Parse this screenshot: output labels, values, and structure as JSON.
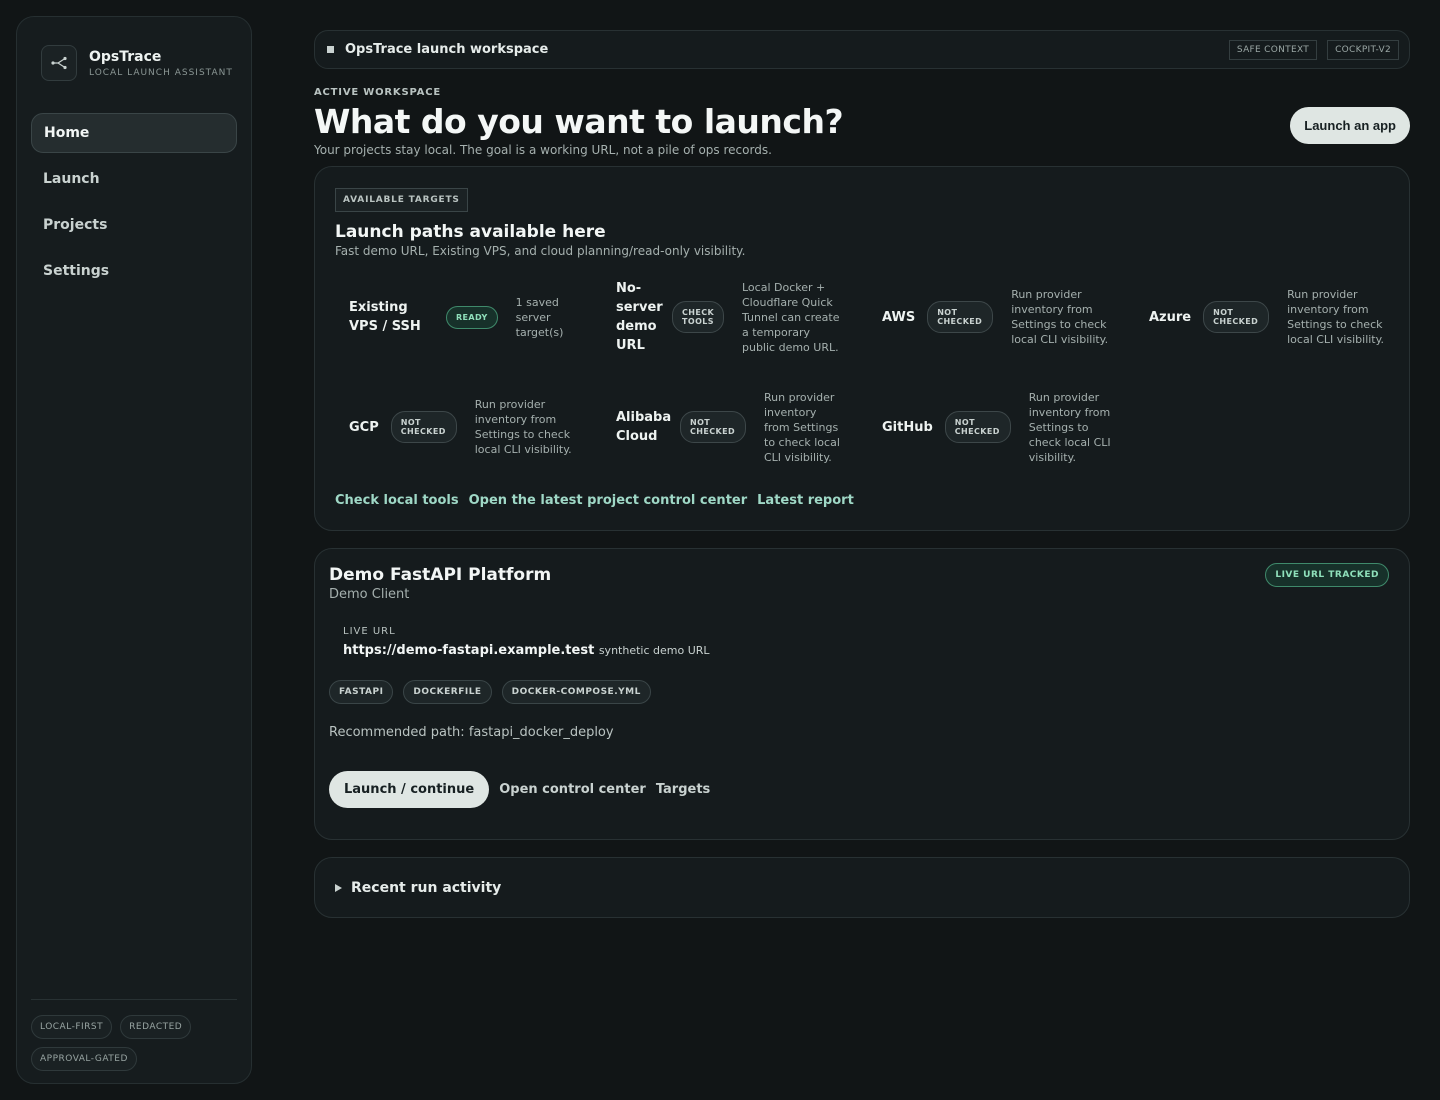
{
  "brand": {
    "name": "OpsTrace",
    "subtitle": "LOCAL LAUNCH ASSISTANT",
    "icon": "share-branch-icon"
  },
  "nav": {
    "items": [
      {
        "label": "Home",
        "active": true
      },
      {
        "label": "Launch",
        "active": false
      },
      {
        "label": "Projects",
        "active": false
      },
      {
        "label": "Settings",
        "active": false
      }
    ]
  },
  "sidebar_pills": [
    "LOCAL-FIRST",
    "REDACTED",
    "APPROVAL-GATED"
  ],
  "topbar": {
    "title": "OpsTrace launch workspace",
    "tags": [
      "SAFE CONTEXT",
      "COCKPIT-V2"
    ]
  },
  "hero": {
    "eyebrow": "ACTIVE WORKSPACE",
    "title": "What do you want to launch?",
    "subtitle": "Your projects stay local. The goal is a working URL, not a pile of ops records.",
    "button": "Launch an app"
  },
  "targets": {
    "badge": "AVAILABLE TARGETS",
    "title": "Launch paths available here",
    "subtitle": "Fast demo URL, Existing VPS, and cloud planning/read-only visibility.",
    "items": [
      {
        "name": "Existing VPS / SSH",
        "status": "READY",
        "desc": "1 saved server target(s)"
      },
      {
        "name": "No-server demo URL",
        "status": "CHECK TOOLS",
        "desc": "Local Docker + Cloudflare Quick Tunnel can create a temporary public demo URL."
      },
      {
        "name": "AWS",
        "status": "NOT CHECKED",
        "desc": "Run provider inventory from Settings to check local CLI visibility."
      },
      {
        "name": "Azure",
        "status": "NOT CHECKED",
        "desc": "Run provider inventory from Settings to check local CLI visibility."
      },
      {
        "name": "GCP",
        "status": "NOT CHECKED",
        "desc": "Run provider inventory from Settings to check local CLI visibility."
      },
      {
        "name": "Alibaba Cloud",
        "status": "NOT CHECKED",
        "desc": "Run provider inventory from Settings to check local CLI visibility."
      },
      {
        "name": "GitHub",
        "status": "NOT CHECKED",
        "desc": "Run provider inventory from Settings to check local CLI visibility."
      }
    ],
    "links": [
      "Check local tools",
      "Open the latest project control center",
      "Latest report"
    ]
  },
  "project": {
    "title": "Demo FastAPI Platform",
    "client": "Demo Client",
    "badge": "LIVE URL TRACKED",
    "live_label": "LIVE URL",
    "live_url": "https://demo-fastapi.example.test",
    "live_note": "synthetic demo URL",
    "chips": [
      "FASTAPI",
      "DOCKERFILE",
      "DOCKER-COMPOSE.YML"
    ],
    "recommended": "Recommended path: fastapi_docker_deploy",
    "primary_action": "Launch / continue",
    "secondary_actions": [
      "Open control center",
      "Targets"
    ]
  },
  "activity": {
    "label": "Recent run activity"
  }
}
